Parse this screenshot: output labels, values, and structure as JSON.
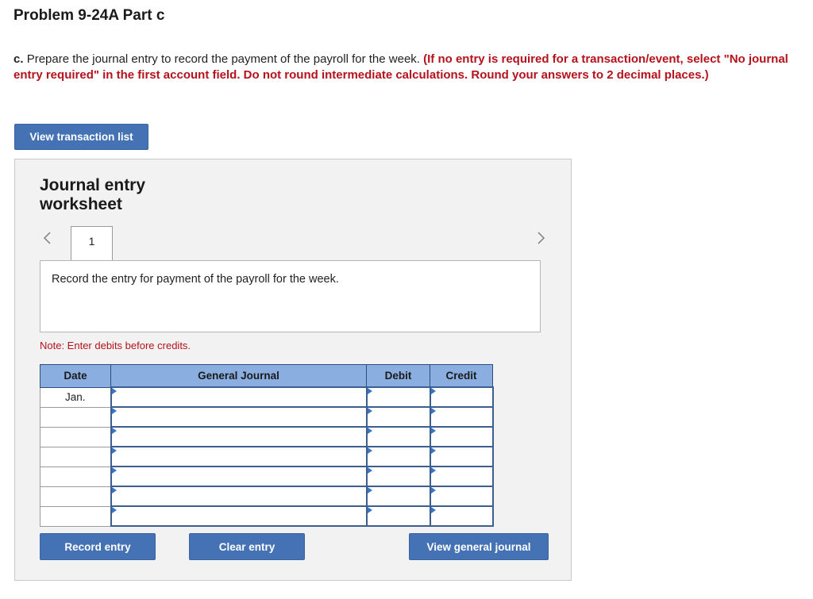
{
  "page": {
    "title": "Problem 9-24A Part c"
  },
  "instructions": {
    "label": "c.",
    "text": "Prepare the journal entry to record the payment of the payroll for the week.",
    "note": "(If no entry is required for a transaction/event, select \"No journal entry required\" in the first account field. Do not round intermediate calculations. Round your answers to 2 decimal places.)"
  },
  "buttons": {
    "view_transaction_list": "View transaction list",
    "record_entry": "Record entry",
    "clear_entry": "Clear entry",
    "view_general_journal": "View general journal"
  },
  "worksheet": {
    "title_line1": "Journal entry",
    "title_line2": "worksheet",
    "tabs": [
      {
        "label": "1"
      }
    ],
    "prompt": "Record the entry for payment of the payroll for the week.",
    "note": "Note: Enter debits before credits."
  },
  "journal_table": {
    "headers": {
      "date": "Date",
      "general_journal": "General Journal",
      "debit": "Debit",
      "credit": "Credit"
    },
    "rows": [
      {
        "date": "Jan.",
        "account": "",
        "debit": "",
        "credit": ""
      },
      {
        "date": "",
        "account": "",
        "debit": "",
        "credit": ""
      },
      {
        "date": "",
        "account": "",
        "debit": "",
        "credit": ""
      },
      {
        "date": "",
        "account": "",
        "debit": "",
        "credit": ""
      },
      {
        "date": "",
        "account": "",
        "debit": "",
        "credit": ""
      },
      {
        "date": "",
        "account": "",
        "debit": "",
        "credit": ""
      },
      {
        "date": "",
        "account": "",
        "debit": "",
        "credit": ""
      }
    ]
  },
  "icons": {
    "prev": "chevron-left-icon",
    "next": "chevron-right-icon"
  },
  "colors": {
    "button_blue": "#4472b4",
    "header_blue": "#8aaee0",
    "instruction_red": "#b5121b",
    "panel_gray": "#f2f2f2"
  }
}
